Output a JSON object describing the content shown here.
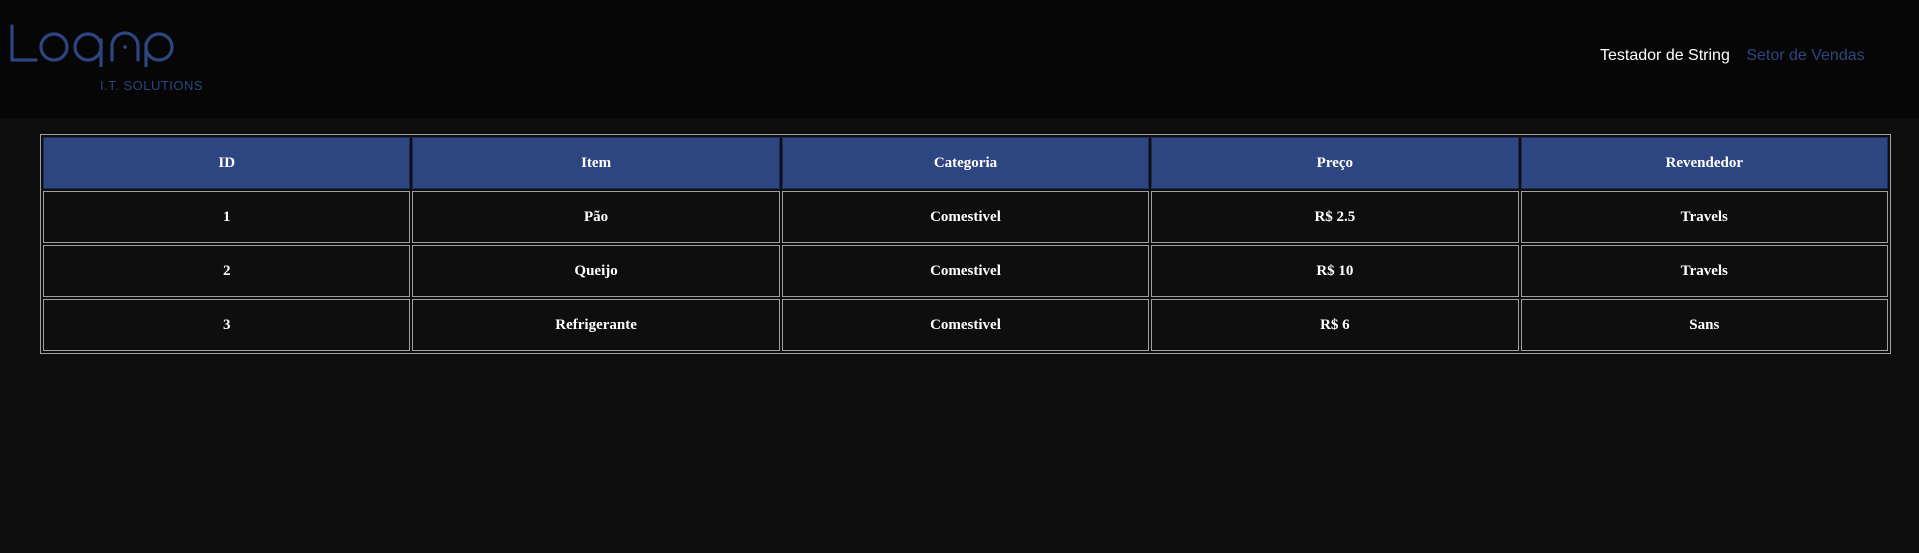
{
  "brand": {
    "logo_text": "Logap",
    "subtitle": "I.T. SOLUTIONS",
    "color": "#2d4580"
  },
  "nav": {
    "items": [
      {
        "label": "Testador de String",
        "active": true
      },
      {
        "label": "Setor de Vendas",
        "active": false
      }
    ]
  },
  "table": {
    "headers": [
      "ID",
      "Item",
      "Categoria",
      "Preço",
      "Revendedor"
    ],
    "rows": [
      [
        "1",
        "Pão",
        "Comestivel",
        "R$ 2.5",
        "Travels"
      ],
      [
        "2",
        "Queijo",
        "Comestivel",
        "R$ 10",
        "Travels"
      ],
      [
        "3",
        "Refrigerante",
        "Comestivel",
        "R$ 6",
        "Sans"
      ]
    ]
  },
  "colors": {
    "accent": "#2d4580",
    "background": "#0e0e0e",
    "header_bg": "#060606"
  }
}
